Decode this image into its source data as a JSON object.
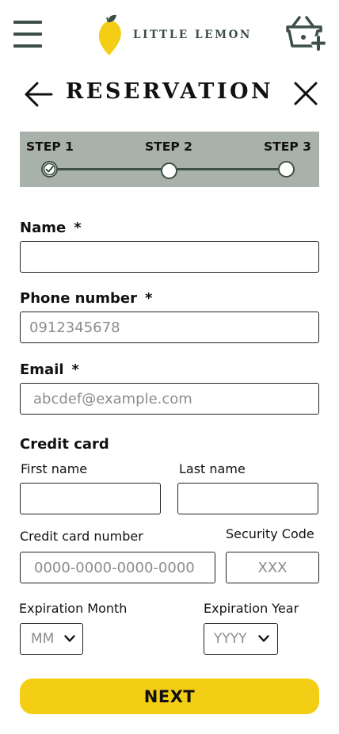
{
  "header": {
    "brand": "LITTLE LEMON",
    "menu_icon": "hamburger-menu-icon",
    "cart_icon": "basket-add-icon",
    "logo_icon": "lemon-icon"
  },
  "page": {
    "title": "RESERVATION",
    "back_icon": "arrow-left-icon",
    "close_icon": "close-icon"
  },
  "stepper": {
    "steps": [
      {
        "label": "STEP 1",
        "state": "completed"
      },
      {
        "label": "STEP 2",
        "state": "pending"
      },
      {
        "label": "STEP 3",
        "state": "pending"
      }
    ]
  },
  "form": {
    "name": {
      "label": "Name",
      "required_mark": "*",
      "value": "",
      "placeholder": ""
    },
    "phone": {
      "label": "Phone number",
      "required_mark": "*",
      "value": "",
      "placeholder": "0912345678"
    },
    "email": {
      "label": "Email",
      "required_mark": "*",
      "value": "",
      "placeholder": "abcdef@example.com"
    },
    "credit_card": {
      "heading": "Credit card",
      "first_name": {
        "label": "First name",
        "value": "",
        "placeholder": ""
      },
      "last_name": {
        "label": "Last name",
        "value": "",
        "placeholder": ""
      },
      "number": {
        "label": "Credit card number",
        "value": "",
        "placeholder": "0000-0000-0000-0000"
      },
      "security_code": {
        "label": "Security Code",
        "value": "",
        "placeholder": "XXX"
      },
      "exp_month": {
        "label": "Expiration Month",
        "selected": "MM"
      },
      "exp_year": {
        "label": "Expiration Year",
        "selected": "YYYY"
      }
    }
  },
  "actions": {
    "next_label": "NEXT"
  },
  "colors": {
    "brand_green": "#3d4f46",
    "brand_yellow": "#f4ce14",
    "stepper_bg": "#a9b1ab"
  }
}
